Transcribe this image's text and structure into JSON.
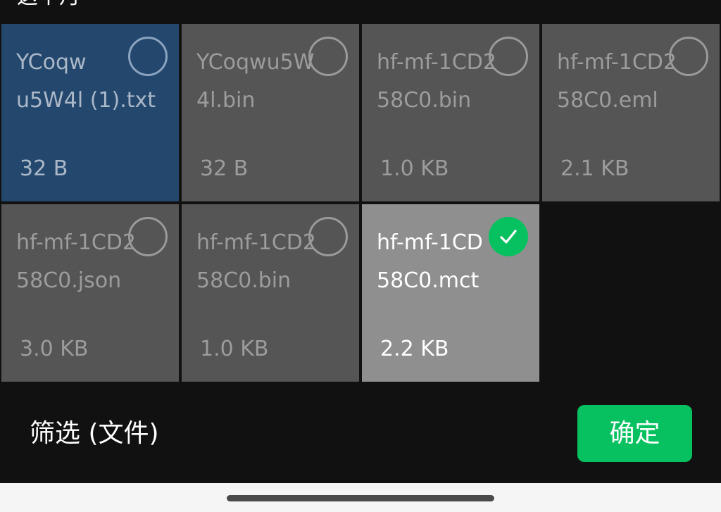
{
  "section": {
    "title": "这个月"
  },
  "files": [
    {
      "name": "YCoqw\nu5W4l (1).txt",
      "size": "32 B",
      "state": "highlighted"
    },
    {
      "name": "YCoqwu5W\n4l.bin",
      "size": "32 B",
      "state": "unselected"
    },
    {
      "name": "hf-mf-1CD2\n58C0.bin",
      "size": "1.0 KB",
      "state": "unselected"
    },
    {
      "name": "hf-mf-1CD2\n58C0.eml",
      "size": "2.1 KB",
      "state": "unselected"
    },
    {
      "name": "hf-mf-1CD2\n58C0.json",
      "size": "3.0 KB",
      "state": "unselected"
    },
    {
      "name": "hf-mf-1CD2\n58C0.bin",
      "size": "1.0 KB",
      "state": "unselected"
    },
    {
      "name": "hf-mf-1CD\n58C0.mct",
      "size": "2.2 KB",
      "state": "selected"
    }
  ],
  "footer": {
    "filter_label": "筛选 (文件)",
    "confirm_label": "确定"
  },
  "colors": {
    "accent": "#07c160",
    "highlight_tile": "#24476d",
    "tile": "#555555",
    "selected_tile": "#8f8f8f",
    "background": "#111111"
  },
  "icons": {
    "select_circle": "radio-circle-icon",
    "selected_check": "checkmark-icon"
  }
}
